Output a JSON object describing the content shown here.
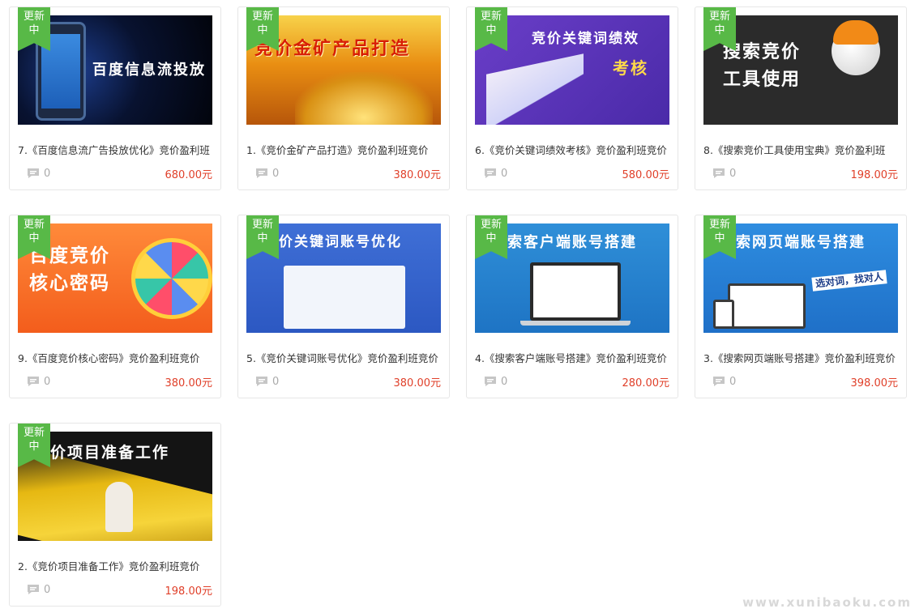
{
  "badge": {
    "line1": "更新",
    "line2": "中"
  },
  "cards": [
    {
      "thumb_text": "百度信息流投放",
      "title": "7.《百度信息流广告投放优化》竞价盈利班",
      "comments": "0",
      "price": "680.00元"
    },
    {
      "thumb_text": "竞价金矿产品打造",
      "title": "1.《竞价金矿产品打造》竞价盈利班竞价",
      "comments": "0",
      "price": "380.00元"
    },
    {
      "thumb_text": "竞价关键词绩效",
      "thumb_text2": "考核",
      "title": "6.《竞价关键词绩效考核》竞价盈利班竞价",
      "comments": "0",
      "price": "580.00元"
    },
    {
      "thumb_text": "搜索竞价",
      "thumb_text2": "工具使用",
      "title": "8.《搜索竞价工具使用宝典》竞价盈利班",
      "comments": "0",
      "price": "198.00元"
    },
    {
      "thumb_text": "百度竞价",
      "thumb_text2": "核心密码",
      "title": "9.《百度竞价核心密码》竞价盈利班竞价",
      "comments": "0",
      "price": "380.00元"
    },
    {
      "thumb_text": "价关键词账号优化",
      "title": "5.《竞价关键词账号优化》竞价盈利班竞价",
      "comments": "0",
      "price": "380.00元"
    },
    {
      "thumb_text": "索客户端账号搭建",
      "title": "4.《搜索客户端账号搭建》竞价盈利班竞价",
      "comments": "0",
      "price": "280.00元"
    },
    {
      "thumb_text": "索网页端账号搭建",
      "thumb_text2": "选对词，找对人",
      "title": "3.《搜索网页端账号搭建》竞价盈利班竞价",
      "comments": "0",
      "price": "398.00元"
    },
    {
      "thumb_text": "价项目准备工作",
      "title": "2.《竞价项目准备工作》竞价盈利班竞价",
      "comments": "0",
      "price": "198.00元"
    }
  ],
  "watermark": "www.xunibaoku.com",
  "colors": {
    "badge": "#58b947",
    "price": "#e0402a",
    "border": "#e6e6e6"
  }
}
